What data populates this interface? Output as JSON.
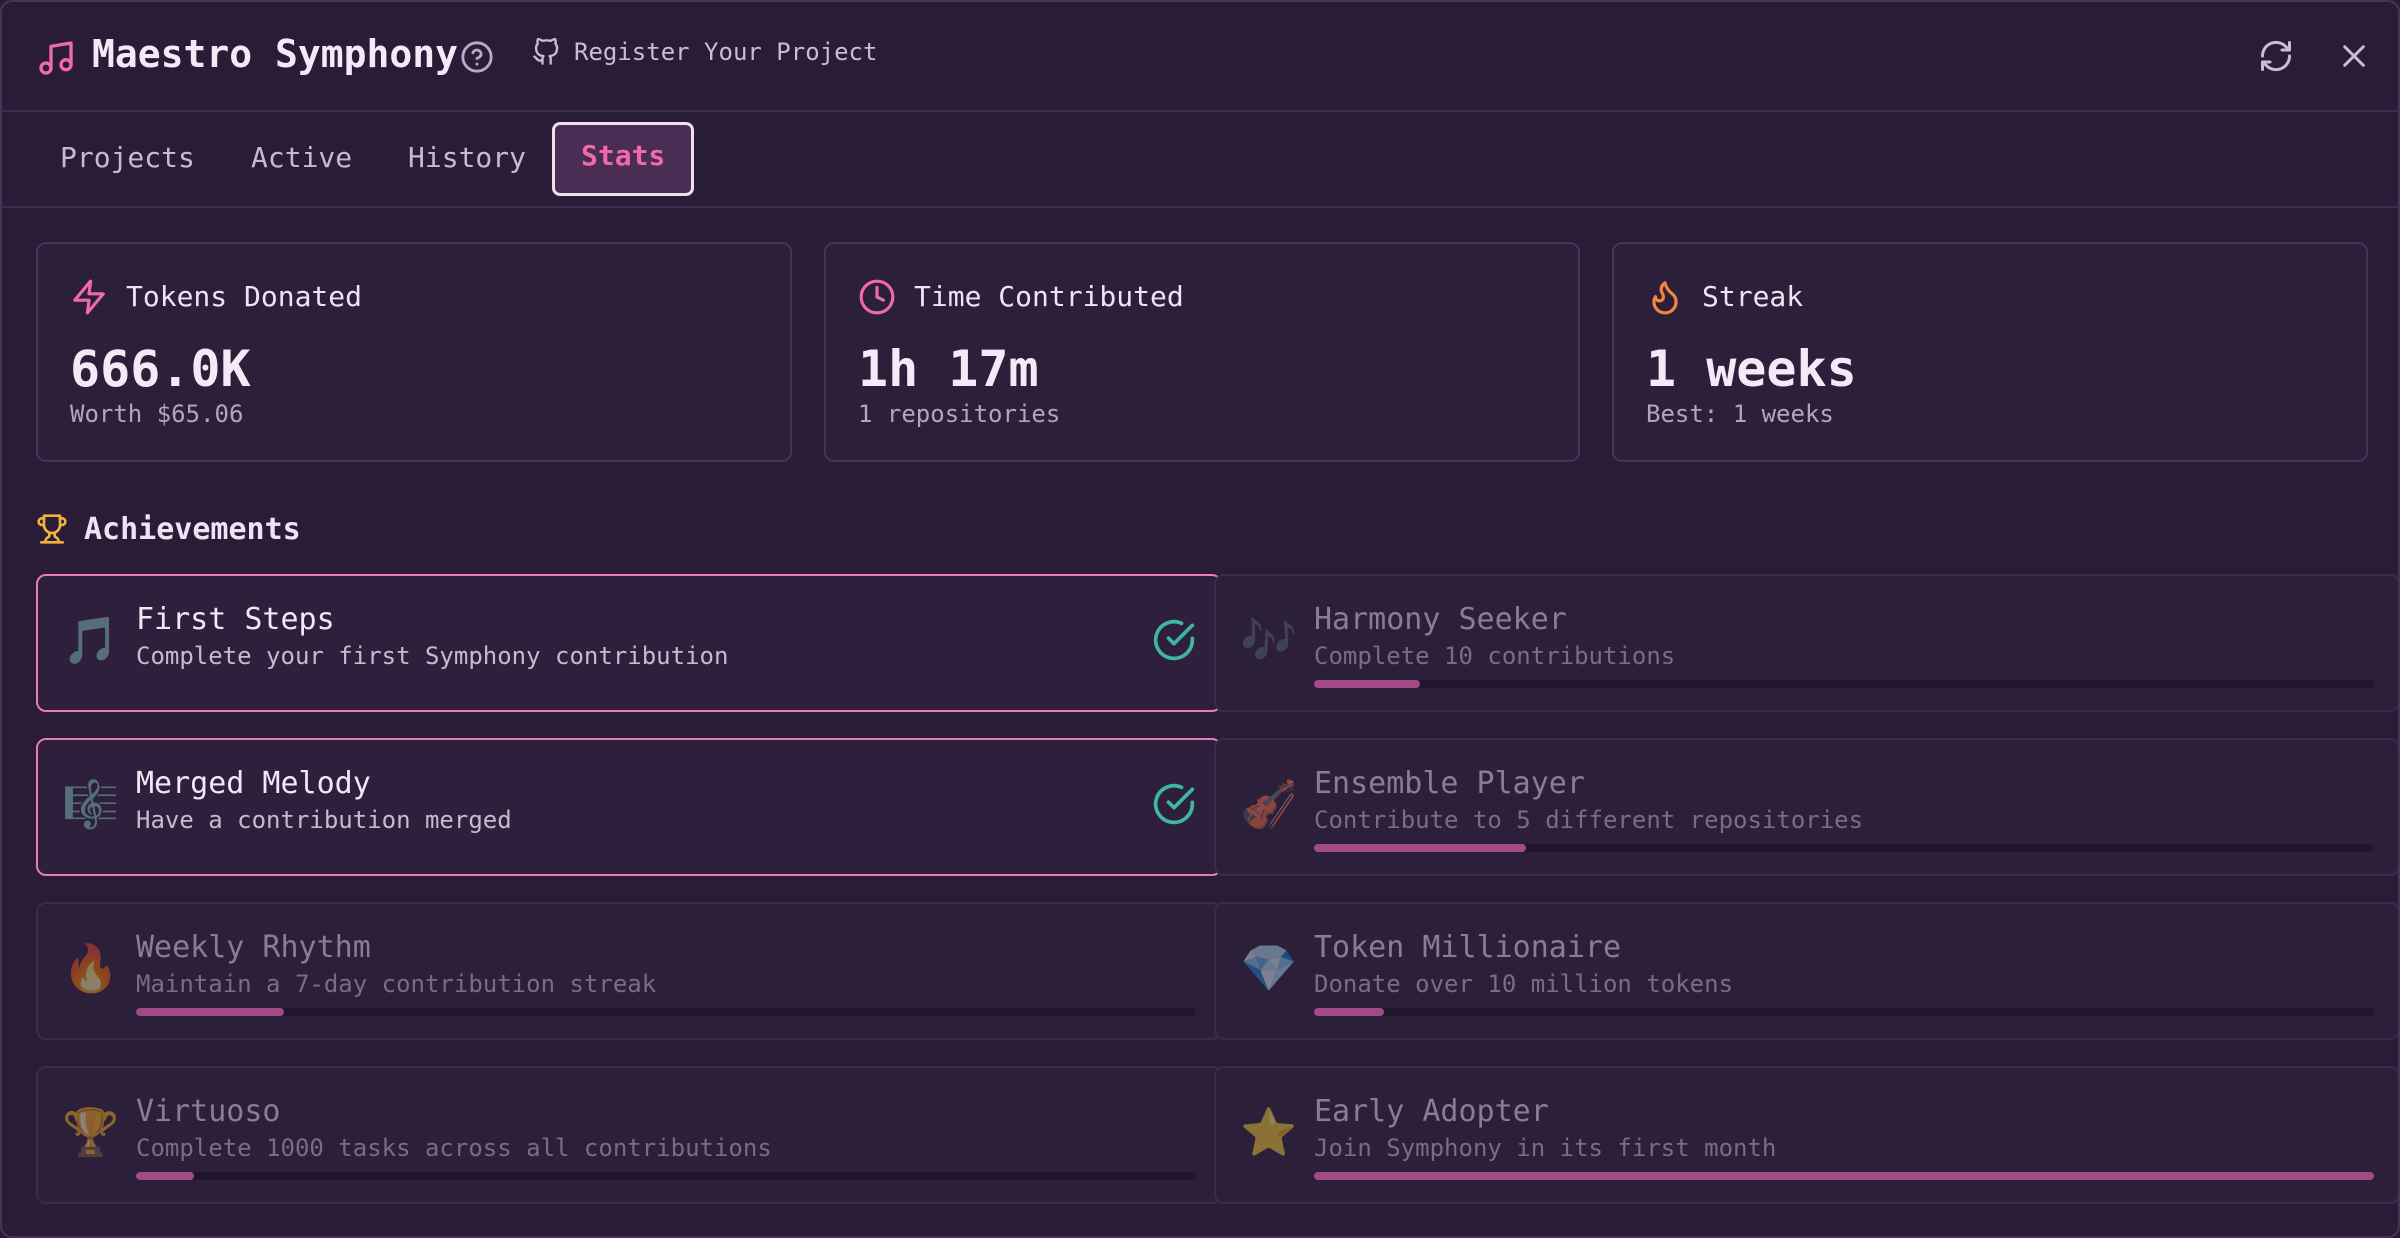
{
  "header": {
    "title": "Maestro Symphony",
    "register_label": "Register Your Project"
  },
  "tabs": [
    {
      "label": "Projects",
      "active": false
    },
    {
      "label": "Active",
      "active": false
    },
    {
      "label": "History",
      "active": false
    },
    {
      "label": "Stats",
      "active": true
    }
  ],
  "stats": {
    "tokens": {
      "heading": "Tokens Donated",
      "value": "666.0K",
      "sub": "Worth $65.06"
    },
    "time": {
      "heading": "Time Contributed",
      "value": "1h 17m",
      "sub": "1 repositories"
    },
    "streak": {
      "heading": "Streak",
      "value": "1 weeks",
      "sub": "Best: 1 weeks"
    }
  },
  "achievements": {
    "title": "Achievements",
    "items": [
      {
        "emoji": "🎵",
        "name": "First Steps",
        "desc": "Complete your first Symphony contribution",
        "unlocked": true,
        "progress": 1.0
      },
      {
        "emoji": "🎶",
        "name": "Harmony Seeker",
        "desc": "Complete 10 contributions",
        "unlocked": false,
        "progress": 0.1
      },
      {
        "emoji": "🎼",
        "name": "Merged Melody",
        "desc": "Have a contribution merged",
        "unlocked": true,
        "progress": 1.0
      },
      {
        "emoji": "🎻",
        "name": "Ensemble Player",
        "desc": "Contribute to 5 different repositories",
        "unlocked": false,
        "progress": 0.2
      },
      {
        "emoji": "🔥",
        "name": "Weekly Rhythm",
        "desc": "Maintain a 7-day contribution streak",
        "unlocked": false,
        "progress": 0.14
      },
      {
        "emoji": "💎",
        "name": "Token Millionaire",
        "desc": "Donate over 10 million tokens",
        "unlocked": false,
        "progress": 0.066
      },
      {
        "emoji": "🏆",
        "name": "Virtuoso",
        "desc": "Complete 1000 tasks across all contributions",
        "unlocked": false,
        "progress": 0.055
      },
      {
        "emoji": "⭐",
        "name": "Early Adopter",
        "desc": "Join Symphony in its first month",
        "unlocked": false,
        "progress": 1.0
      }
    ]
  },
  "colors": {
    "accent": "#f06aa8",
    "background": "#2a1c36",
    "success": "#3fb5a3",
    "streak": "#f0873a",
    "trophy": "#f2b33d"
  }
}
